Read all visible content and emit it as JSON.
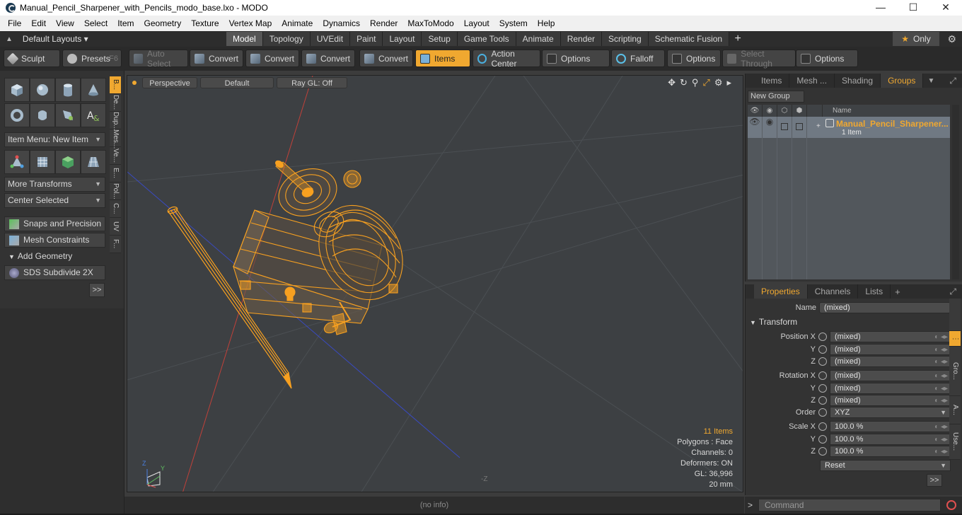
{
  "window": {
    "title": "Manual_Pencil_Sharpener_with_Pencils_modo_base.lxo - MODO",
    "controls": [
      "—",
      "☐",
      "✕"
    ]
  },
  "menu": [
    "File",
    "Edit",
    "View",
    "Select",
    "Item",
    "Geometry",
    "Texture",
    "Vertex Map",
    "Animate",
    "Dynamics",
    "Render",
    "MaxToModo",
    "Layout",
    "System",
    "Help"
  ],
  "layoutbar": {
    "layouts_label": "Default Layouts ▾",
    "tabs": [
      "Model",
      "Topology",
      "UVEdit",
      "Paint",
      "Layout",
      "Setup",
      "Game Tools",
      "Animate",
      "Render",
      "Scripting",
      "Schematic Fusion"
    ],
    "active_tab": "Model",
    "only_label": "Only"
  },
  "toolbar": {
    "sculpt": "Sculpt",
    "presets": "Presets",
    "presets_key": "F6",
    "auto_select": "Auto Select",
    "convert": "Convert",
    "items": "Items",
    "action_center": "Action Center",
    "options": "Options",
    "falloff": "Falloff",
    "select_through": "Select Through"
  },
  "leftpanel": {
    "vtabs": [
      "B...",
      "De...",
      "Dup...",
      "Mes...",
      "Ve...",
      "E...",
      "Pol...",
      "C...",
      "UV",
      "F..."
    ],
    "item_menu": "Item Menu: New Item",
    "more_transforms": "More Transforms",
    "center_selected": "Center Selected",
    "snaps": "Snaps and Precision",
    "mesh_constraints": "Mesh Constraints",
    "add_geometry": "Add Geometry",
    "sds": "SDS Subdivide 2X",
    "more": ">>"
  },
  "viewport": {
    "perspective": "Perspective",
    "default": "Default",
    "raygl": "Ray GL: Off",
    "stats": {
      "items": "11 Items",
      "polygons": "Polygons : Face",
      "channels": "Channels: 0",
      "deformers": "Deformers: ON",
      "gl": "GL: 36,996",
      "scale": "20 mm"
    },
    "axis_z": "Z",
    "axis_y": "Y",
    "bottom_z": "-Z"
  },
  "status": {
    "info": "(no info)"
  },
  "groups_panel": {
    "tabs": [
      "Items",
      "Mesh ...",
      "Shading",
      "Groups"
    ],
    "active_tab": "Groups",
    "new_group": "New Group",
    "col_name": "Name",
    "row": {
      "name": "Manual_Pencil_Sharpener...",
      "sub": "1 Item"
    }
  },
  "properties_panel": {
    "tabs": [
      "Properties",
      "Channels",
      "Lists"
    ],
    "active_tab": "Properties",
    "name_label": "Name",
    "name_value": "(mixed)",
    "transform": "Transform",
    "position_x": "Position X",
    "rotation_x": "Rotation X",
    "scale_x": "Scale X",
    "axis_y": "Y",
    "axis_z": "Z",
    "order_label": "Order",
    "order_value": "XYZ",
    "mixed": "(mixed)",
    "scale_value": "100.0 %",
    "reset": "Reset",
    "more": ">>",
    "vtabs": [
      "Gro...",
      "A...",
      "Use..."
    ]
  },
  "command": {
    "placeholder": "Command"
  },
  "colors": {
    "accent": "#f0a830",
    "wire": "#f7a020",
    "bg": "#3d4043"
  }
}
